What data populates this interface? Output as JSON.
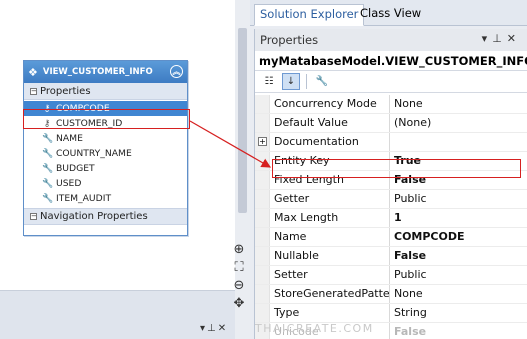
{
  "designer": {
    "entity": {
      "name": "VIEW_CUSTOMER_INFO",
      "sections": {
        "properties": "Properties",
        "navigation": "Navigation Properties"
      },
      "properties": [
        {
          "name": "COMPCODE",
          "icon": "key-icon",
          "selected": true
        },
        {
          "name": "CUSTOMER_ID",
          "icon": "key-icon",
          "selected": false
        },
        {
          "name": "NAME",
          "icon": "wrench-icon",
          "selected": false
        },
        {
          "name": "COUNTRY_NAME",
          "icon": "wrench-icon",
          "selected": false
        },
        {
          "name": "BUDGET",
          "icon": "wrench-icon",
          "selected": false
        },
        {
          "name": "USED",
          "icon": "wrench-icon",
          "selected": false
        },
        {
          "name": "ITEM_AUDIT",
          "icon": "wrench-icon",
          "selected": false
        }
      ]
    },
    "tools": [
      "zoom-in-icon",
      "zoom-fit-icon",
      "zoom-out-icon",
      "pan-icon"
    ]
  },
  "tabs": [
    {
      "label": "Solution Explorer",
      "active": true
    },
    {
      "label": "Class View",
      "active": false
    }
  ],
  "properties_panel": {
    "title": "Properties",
    "object": "myMatabaseModel.VIEW_CUSTOMER_INFO.C",
    "rows": [
      {
        "name": "Concurrency Mode",
        "value": "None",
        "bold": false
      },
      {
        "name": "Default Value",
        "value": "(None)",
        "bold": false
      },
      {
        "name": "Documentation",
        "value": "",
        "bold": false,
        "expandable": true
      },
      {
        "name": "Entity Key",
        "value": "True",
        "bold": true
      },
      {
        "name": "Fixed Length",
        "value": "False",
        "bold": true
      },
      {
        "name": "Getter",
        "value": "Public",
        "bold": false
      },
      {
        "name": "Max Length",
        "value": "1",
        "bold": true
      },
      {
        "name": "Name",
        "value": "COMPCODE",
        "bold": true
      },
      {
        "name": "Nullable",
        "value": "False",
        "bold": true
      },
      {
        "name": "Setter",
        "value": "Public",
        "bold": false
      },
      {
        "name": "StoreGeneratedPattern",
        "value": "None",
        "bold": false
      },
      {
        "name": "Type",
        "value": "String",
        "bold": false
      },
      {
        "name": "Unicode",
        "value": "False",
        "bold": true,
        "faded": true
      }
    ]
  },
  "watermark": "THAICREATE.COM",
  "colors": {
    "entity_header": "#4a8bd0",
    "selection": "#3f86d2",
    "highlight": "#d62020"
  }
}
